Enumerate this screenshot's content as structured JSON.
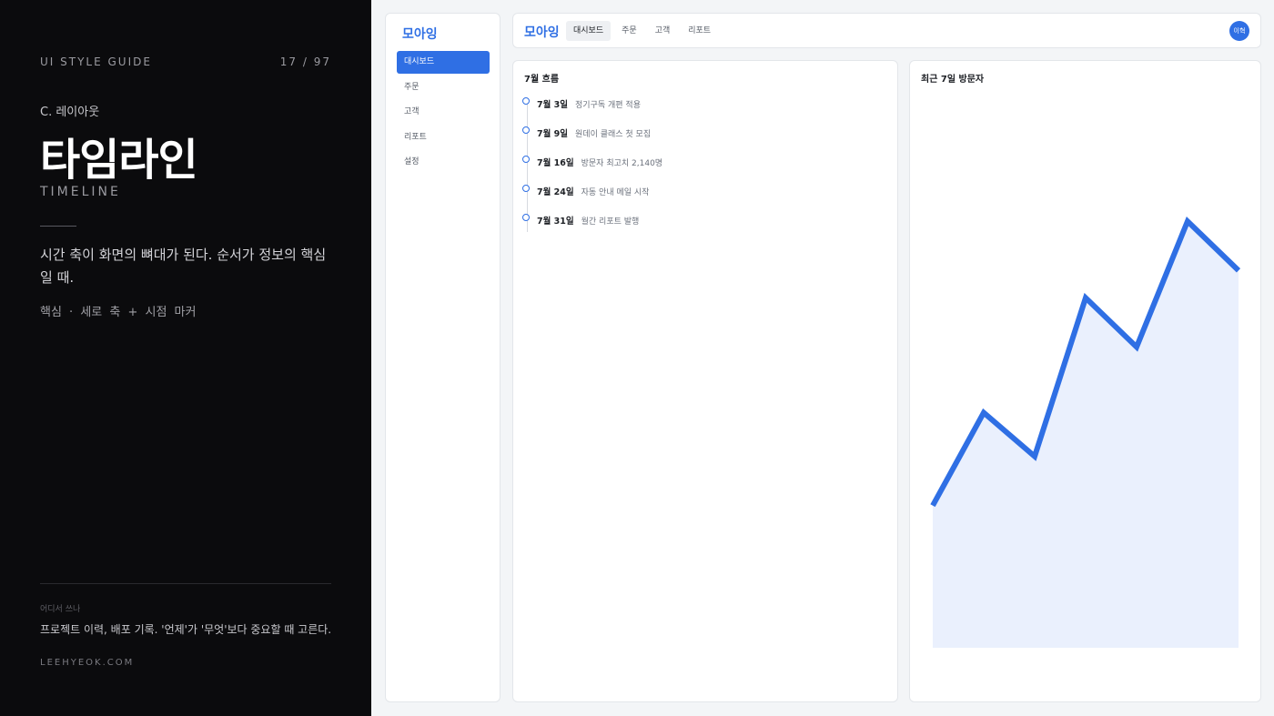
{
  "guide": {
    "label": "UI STYLE GUIDE",
    "page": "17 / 97",
    "section": "C. 레이아웃",
    "title": "타임라인",
    "subtitle": "TIMELINE",
    "description": "시간 축이 화면의 뼈대가 된다. 순서가 정보의 핵심일 때.",
    "key_points": "핵심 · 세로 축 + 시점 마커",
    "where_label": "어디서 쓰나",
    "where_text": "프로젝트 이력, 배포 기록. '언제'가 '무엇'보다 중요할 때 고른다.",
    "site": "LEEHYEOK.COM"
  },
  "app": {
    "logo": "모아잉",
    "sidebar_items": [
      {
        "label": "대시보드",
        "active": true
      },
      {
        "label": "주문",
        "active": false
      },
      {
        "label": "고객",
        "active": false
      },
      {
        "label": "리포트",
        "active": false
      },
      {
        "label": "설정",
        "active": false
      }
    ],
    "tabs": [
      {
        "label": "대시보드",
        "active": true
      },
      {
        "label": "주문",
        "active": false
      },
      {
        "label": "고객",
        "active": false
      },
      {
        "label": "리포트",
        "active": false
      }
    ],
    "avatar": "이혁",
    "accent_color": "#2f6fe4"
  },
  "timeline": {
    "title": "7월 흐름",
    "events": [
      {
        "date": "7월 3일",
        "text": "정기구독 개편 적용"
      },
      {
        "date": "7월 9일",
        "text": "원데이 클래스 첫 모집"
      },
      {
        "date": "7월 16일",
        "text": "방문자 최고치 2,140명"
      },
      {
        "date": "7월 24일",
        "text": "자동 안내 메일 시작"
      },
      {
        "date": "7월 31일",
        "text": "월간 리포트 발행"
      }
    ]
  },
  "chart_data": {
    "type": "area",
    "title": "최근 7일 방문자",
    "x": [
      1,
      2,
      3,
      4,
      5,
      6,
      7
    ],
    "values": [
      26,
      43,
      35,
      64,
      55,
      78,
      69
    ],
    "ylim": [
      0,
      100
    ],
    "grid": false,
    "line_color": "#2f6fe4",
    "fill_color": "#eaf0fd"
  }
}
